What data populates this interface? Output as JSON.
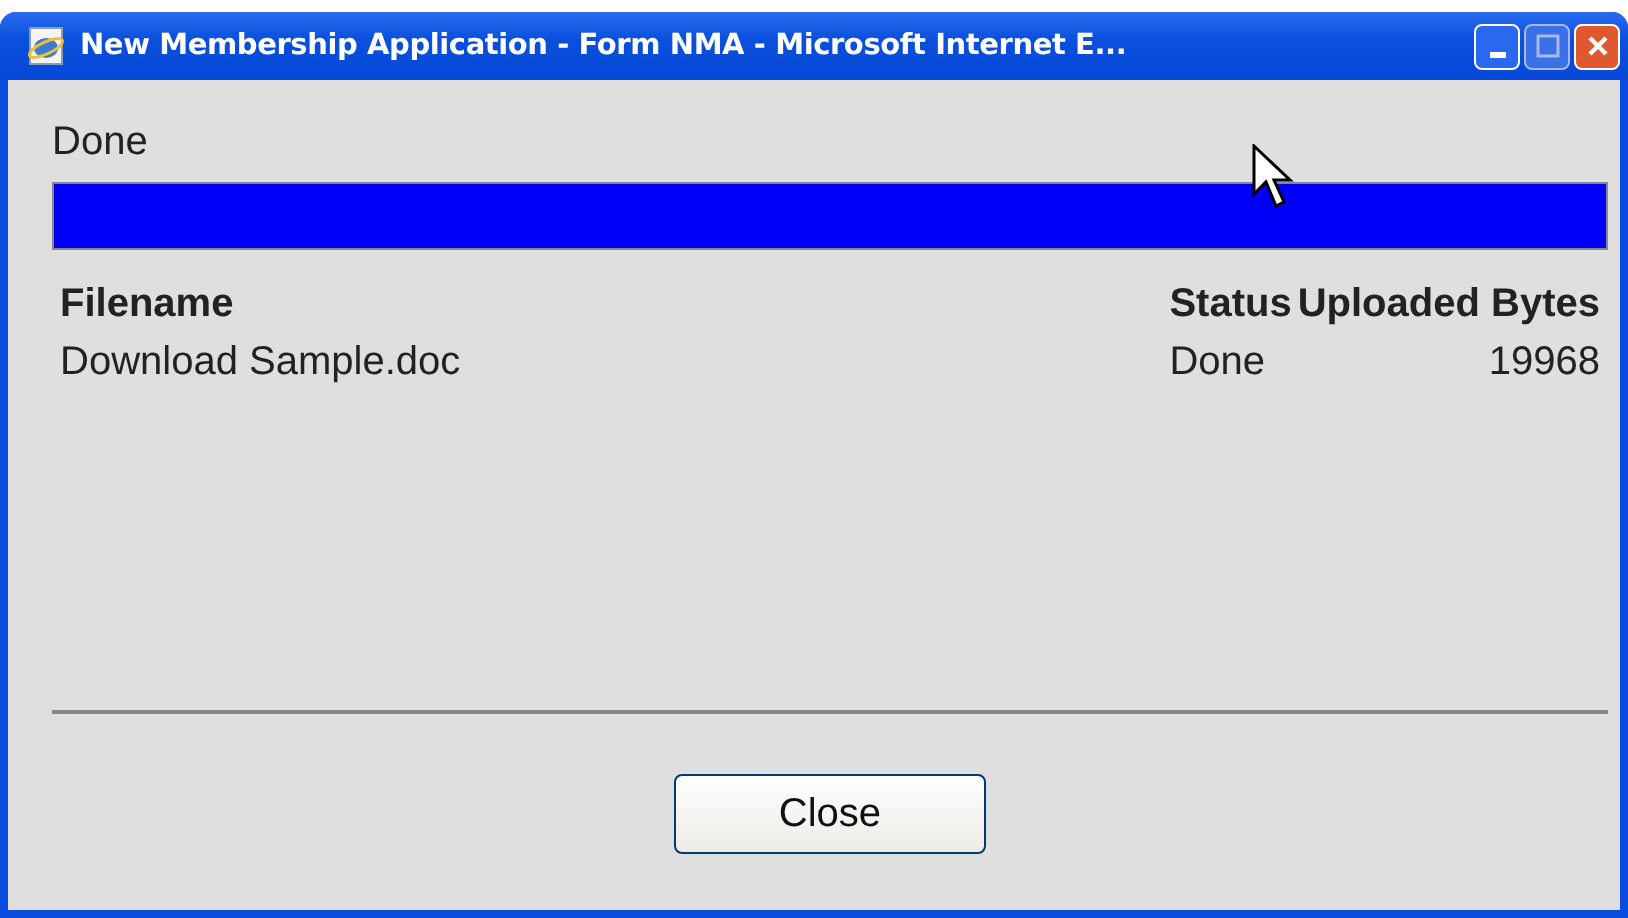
{
  "window": {
    "title": "New Membership Application - Form NMA - Microsoft Internet E..."
  },
  "status_text": "Done",
  "progress": {
    "level": 1
  },
  "table": {
    "columns": [
      "Filename",
      "Status",
      "Uploaded Bytes"
    ],
    "rows": [
      {
        "filename": "Download Sample.doc",
        "status": "Done",
        "uploaded_bytes": "19968"
      }
    ]
  },
  "buttons": [
    "Close"
  ]
}
